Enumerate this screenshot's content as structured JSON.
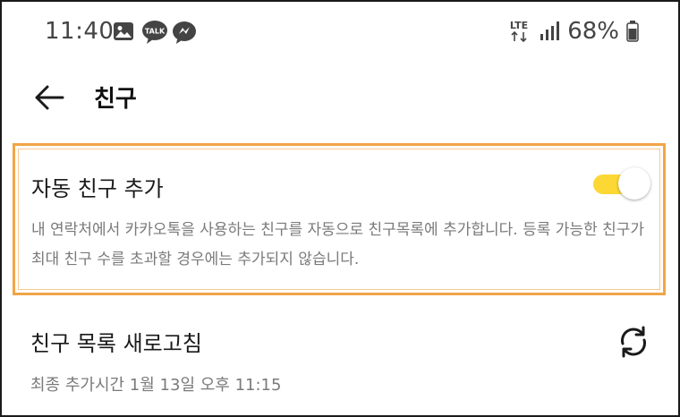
{
  "status_bar": {
    "time": "11:40",
    "network": "LTE",
    "battery": "68%",
    "talk_badge": "TALK",
    "icons": [
      "gallery-icon",
      "kakaotalk-icon",
      "messenger-icon",
      "signal-icon",
      "battery-icon"
    ]
  },
  "app_bar": {
    "title": "친구"
  },
  "auto_add": {
    "title": "자동 친구 추가",
    "description": "내 연락처에서 카카오톡을 사용하는 친구를 자동으로 친구목록에 추가합니다. 등록 가능한 친구가 최대 친구 수를 초과할 경우에는 추가되지 않습니다.",
    "enabled": true
  },
  "refresh": {
    "title": "친구 목록 새로고침",
    "last_added": "최종 추가시간 1월 13일 오후 11:15"
  },
  "colors": {
    "highlight": "#f2a546",
    "toggle_on": "#fdd835",
    "secondary_text": "#7a7a7a"
  }
}
